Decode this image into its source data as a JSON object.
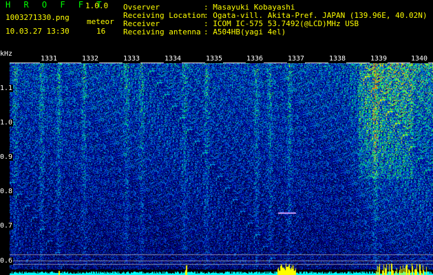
{
  "app": {
    "name": "H R O F F T",
    "version": "1.0.0"
  },
  "file": {
    "name": "1003271330.png",
    "timestamp": "10.03.27 13:30"
  },
  "meteor": {
    "label": "meteor",
    "count": "16"
  },
  "meta": [
    {
      "key": "Ovserver",
      "value": ": Masayuki Kobayashi"
    },
    {
      "key": "Receiving Location",
      "value": ": Ogata-vill. Akita-Pref. JAPAN (139.96E, 40.02N)"
    },
    {
      "key": "Receiver",
      "value": ": ICOM IC-575 53.7492(@LCD)MHz USB"
    },
    {
      "key": "Receiving antenna",
      "value": ": A504HB(yagi 4el)"
    }
  ],
  "axis": {
    "y_unit": "kHz",
    "y_ticks": [
      "1.1",
      "1.0",
      "0.9",
      "0.8",
      "0.7",
      "0.6"
    ],
    "x_ticks": [
      "1331",
      "1332",
      "1333",
      "1334",
      "1335",
      "1336",
      "1337",
      "1338",
      "1339",
      "1340"
    ]
  },
  "colors": {
    "background": "#000000",
    "header_text": "#ffff00",
    "brand": "#00ff00",
    "axis_text": "#ffffff",
    "signal_bar": "#00ffff",
    "signal_peak": "#ffff00"
  }
}
